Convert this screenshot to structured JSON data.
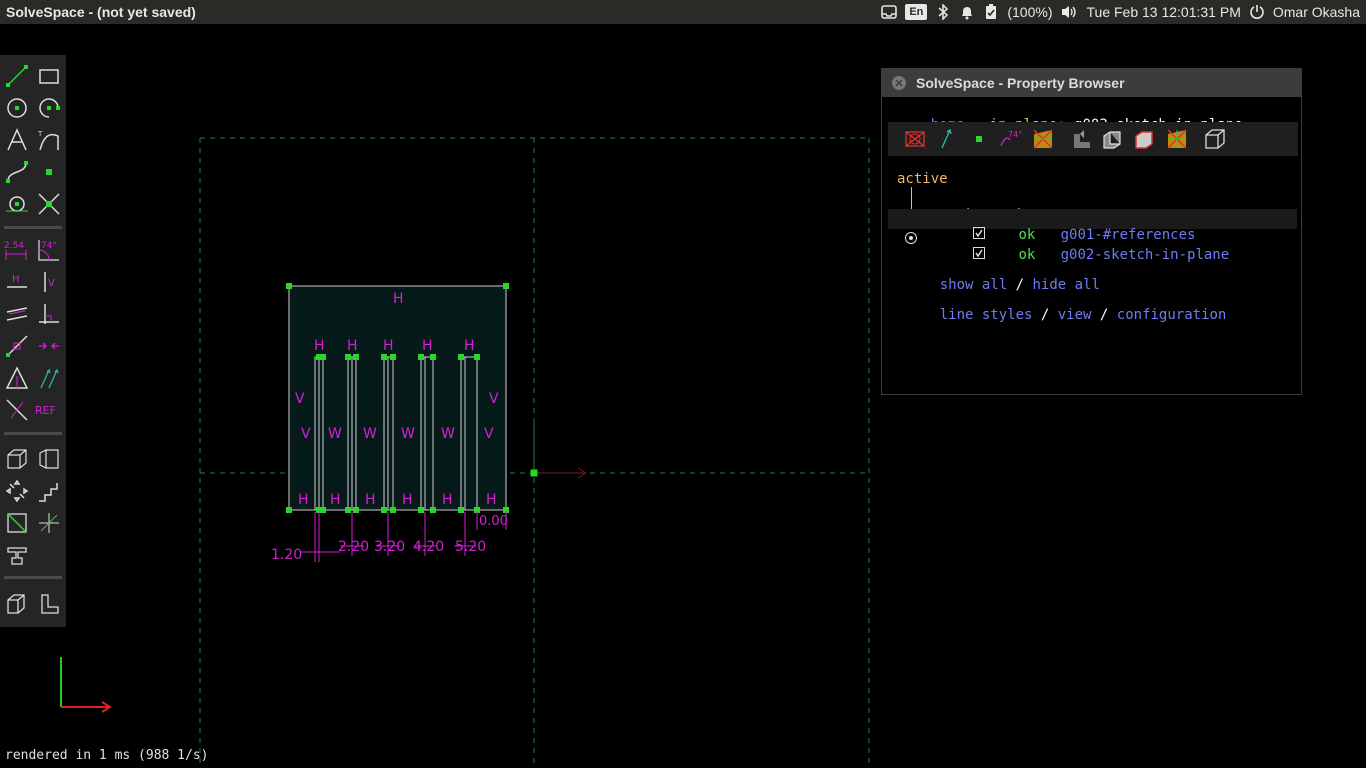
{
  "topbar": {
    "app_title": "SolveSpace - (not yet saved)",
    "lang": "En",
    "battery": "(100%)",
    "clock": "Tue Feb 13 12:01:31 PM",
    "user": "Omar Okasha"
  },
  "property_browser": {
    "title": "SolveSpace - Property Browser",
    "home_link": "home",
    "in_plane_label": "in plane:",
    "in_plane_value": "g002-sketch-in-plane",
    "active_label": "active",
    "col_shown": "shown",
    "col_ok": "ok",
    "col_group": "group-name",
    "groups": [
      {
        "ok": "ok",
        "name": "g001-#references"
      },
      {
        "ok": "ok",
        "name": "g002-sketch-in-plane"
      }
    ],
    "show_all": "show all",
    "sep1": "/",
    "hide_all": "hide all",
    "line_styles": "line styles",
    "sep2": "/",
    "view": "view",
    "sep3": "/",
    "configuration": "configuration"
  },
  "toolbar": {
    "dim_label": "2.54",
    "angle_label": "74°",
    "h_label": "H",
    "v_label": "V",
    "ref_label": "REF"
  },
  "sketch": {
    "constraint_h": "H",
    "constraint_v": "V",
    "constraint_w": "W",
    "dims": [
      "1.20",
      "2.20",
      "3.20",
      "4.20",
      "5.20",
      "0.00"
    ]
  },
  "status": "rendered in 1 ms (988 1/s)",
  "colors": {
    "constraint": "#d51fd5",
    "entity": "#29d629",
    "link": "#6f7cf5",
    "workplane": "#1f7a6a"
  }
}
